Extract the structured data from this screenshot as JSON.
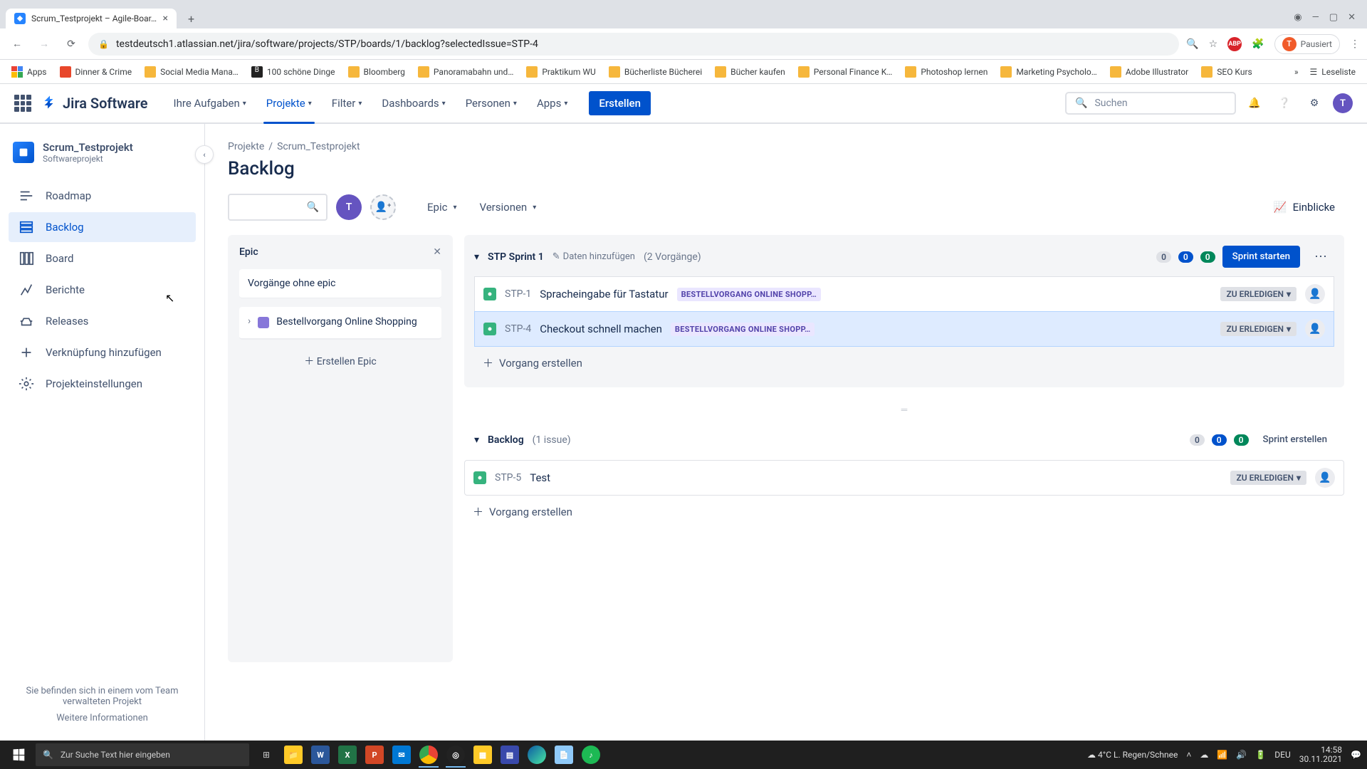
{
  "browser": {
    "tab_title": "Scrum_Testprojekt – Agile-Boar…",
    "url": "testdeutsch1.atlassian.net/jira/software/projects/STP/boards/1/backlog?selectedIssue=STP-4",
    "pause_label": "Pausiert",
    "window": {
      "min": "—",
      "max": "▢",
      "close": "✕"
    }
  },
  "bookmarks": {
    "apps": "Apps",
    "items": [
      "Dinner & Crime",
      "Social Media Mana…",
      "100 schöne Dinge",
      "Bloomberg",
      "Panoramabahn und…",
      "Praktikum WU",
      "Bücherliste Bücherei",
      "Bücher kaufen",
      "Personal Finance K…",
      "Photoshop lernen",
      "Marketing Psycholo…",
      "Adobe Illustrator",
      "SEO Kurs"
    ],
    "readlist": "Leseliste"
  },
  "nav": {
    "product": "Jira Software",
    "items": {
      "your_work": "Ihre Aufgaben",
      "projects": "Projekte",
      "filters": "Filter",
      "dashboards": "Dashboards",
      "people": "Personen",
      "apps": "Apps"
    },
    "create": "Erstellen",
    "search_placeholder": "Suchen",
    "avatar_initial": "T"
  },
  "sidebar": {
    "project_name": "Scrum_Testprojekt",
    "project_type": "Softwareprojekt",
    "items": {
      "roadmap": "Roadmap",
      "backlog": "Backlog",
      "board": "Board",
      "reports": "Berichte",
      "releases": "Releases",
      "addlink": "Verknüpfung hinzufügen",
      "settings": "Projekteinstellungen"
    },
    "footer_text": "Sie befinden sich in einem vom Team verwalteten Projekt",
    "footer_link": "Weitere Informationen"
  },
  "header": {
    "breadcrumb_root": "Projekte",
    "breadcrumb_project": "Scrum_Testprojekt",
    "title": "Backlog"
  },
  "filters": {
    "epic": "Epic",
    "versions": "Versionen",
    "insights": "Einblicke",
    "avatar_initial": "T"
  },
  "epic_panel": {
    "title": "Epic",
    "no_epic": "Vorgänge ohne epic",
    "epic_name": "Bestellvorgang Online Shopping",
    "create": "Erstellen Epic"
  },
  "sprint": {
    "name": "STP Sprint 1",
    "add_data": "Daten hinzufügen",
    "count": "(2 Vorgänge)",
    "pill_grey": "0",
    "pill_blue": "0",
    "pill_green": "0",
    "start": "Sprint starten",
    "create_issue": "Vorgang erstellen",
    "issues": [
      {
        "key": "STP-1",
        "title": "Spracheingabe für Tastatur",
        "epic": "BESTELLVORGANG ONLINE SHOPP…",
        "status": "ZU ERLEDIGEN"
      },
      {
        "key": "STP-4",
        "title": "Checkout schnell machen",
        "epic": "BESTELLVORGANG ONLINE SHOPP…",
        "status": "ZU ERLEDIGEN"
      }
    ]
  },
  "backlog": {
    "name": "Backlog",
    "count": "(1 issue)",
    "pill_grey": "0",
    "pill_blue": "0",
    "pill_green": "0",
    "create_sprint": "Sprint erstellen",
    "create_issue": "Vorgang erstellen",
    "issues": [
      {
        "key": "STP-5",
        "title": "Test",
        "status": "ZU ERLEDIGEN"
      }
    ]
  },
  "taskbar": {
    "search_placeholder": "Zur Suche Text hier eingeben",
    "weather": "4°C  L. Regen/Schnee",
    "lang": "DEU",
    "time": "14:58",
    "date": "30.11.2021"
  }
}
